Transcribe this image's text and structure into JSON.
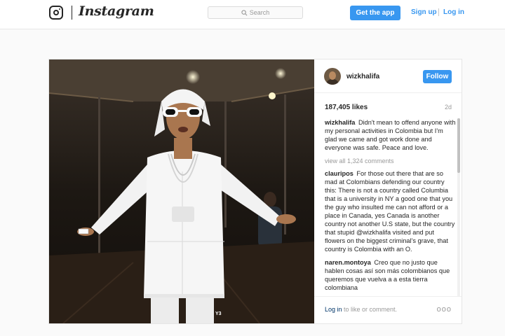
{
  "header": {
    "brand": "Instagram",
    "search_placeholder": "Search",
    "get_app_label": "Get the app",
    "signup_label": "Sign up",
    "login_label": "Log in"
  },
  "post": {
    "photo_watermark": "Y3",
    "username": "wizkhalifa",
    "follow_label": "Follow",
    "likes": "187,405 likes",
    "age": "2d",
    "caption": {
      "user": "wizkhalifa",
      "text": "Didn't mean to offend anyone with my personal activities in Colombia but I'm glad we came and got work done and everyone was safe. Peace and love."
    },
    "view_all_comments": "view all 1,324 comments",
    "comments": [
      {
        "user": "clauripos",
        "text": "For those out there that are so mad at Colombians defending our country this: There is not a country called Columbia that is a university in NY a good one that you the guy who insulted me can not afford or a place in Canada, yes Canada is another country not another U.S state, but the country that stupid @wizkhalifa visited and put flowers on the biggest criminal's grave, that country is Colombia with an O."
      },
      {
        "user": "naren.montoya",
        "text": "Creo que no justo que hablen cosas así son más colombianos que queremos que vuelva a a esta tierra colombiana"
      }
    ],
    "footer_login_link": "Log in",
    "footer_login_rest": " to like or comment.",
    "more_label": "ooo"
  },
  "colors": {
    "accent": "#3897f0",
    "text": "#262626",
    "muted": "#999999",
    "background": "#fafafa"
  },
  "icons": [
    "instagram-glyph-icon",
    "search-icon"
  ]
}
